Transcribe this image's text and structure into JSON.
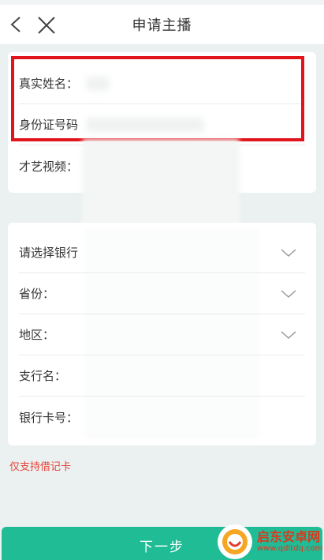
{
  "header": {
    "title": "申请主播",
    "back_icon": "chevron-left-icon",
    "close_icon": "close-icon"
  },
  "personal_info": {
    "real_name_label": "真实姓名：",
    "id_number_label": "身份证号码",
    "talent_video_label": "才艺视频："
  },
  "bank_info": {
    "bank_label": "请选择银行",
    "province_label": "省份：",
    "region_label": "地区：",
    "branch_label": "支行名：",
    "card_number_label": "银行卡号："
  },
  "notice": "仅支持借记卡",
  "next_button_label": "下一步",
  "watermark": {
    "title": "启东安卓网",
    "url": "www.qdltdq.com"
  },
  "colors": {
    "accent": "#1fbc96",
    "highlight": "#e0141a",
    "notice": "#e5443a"
  }
}
